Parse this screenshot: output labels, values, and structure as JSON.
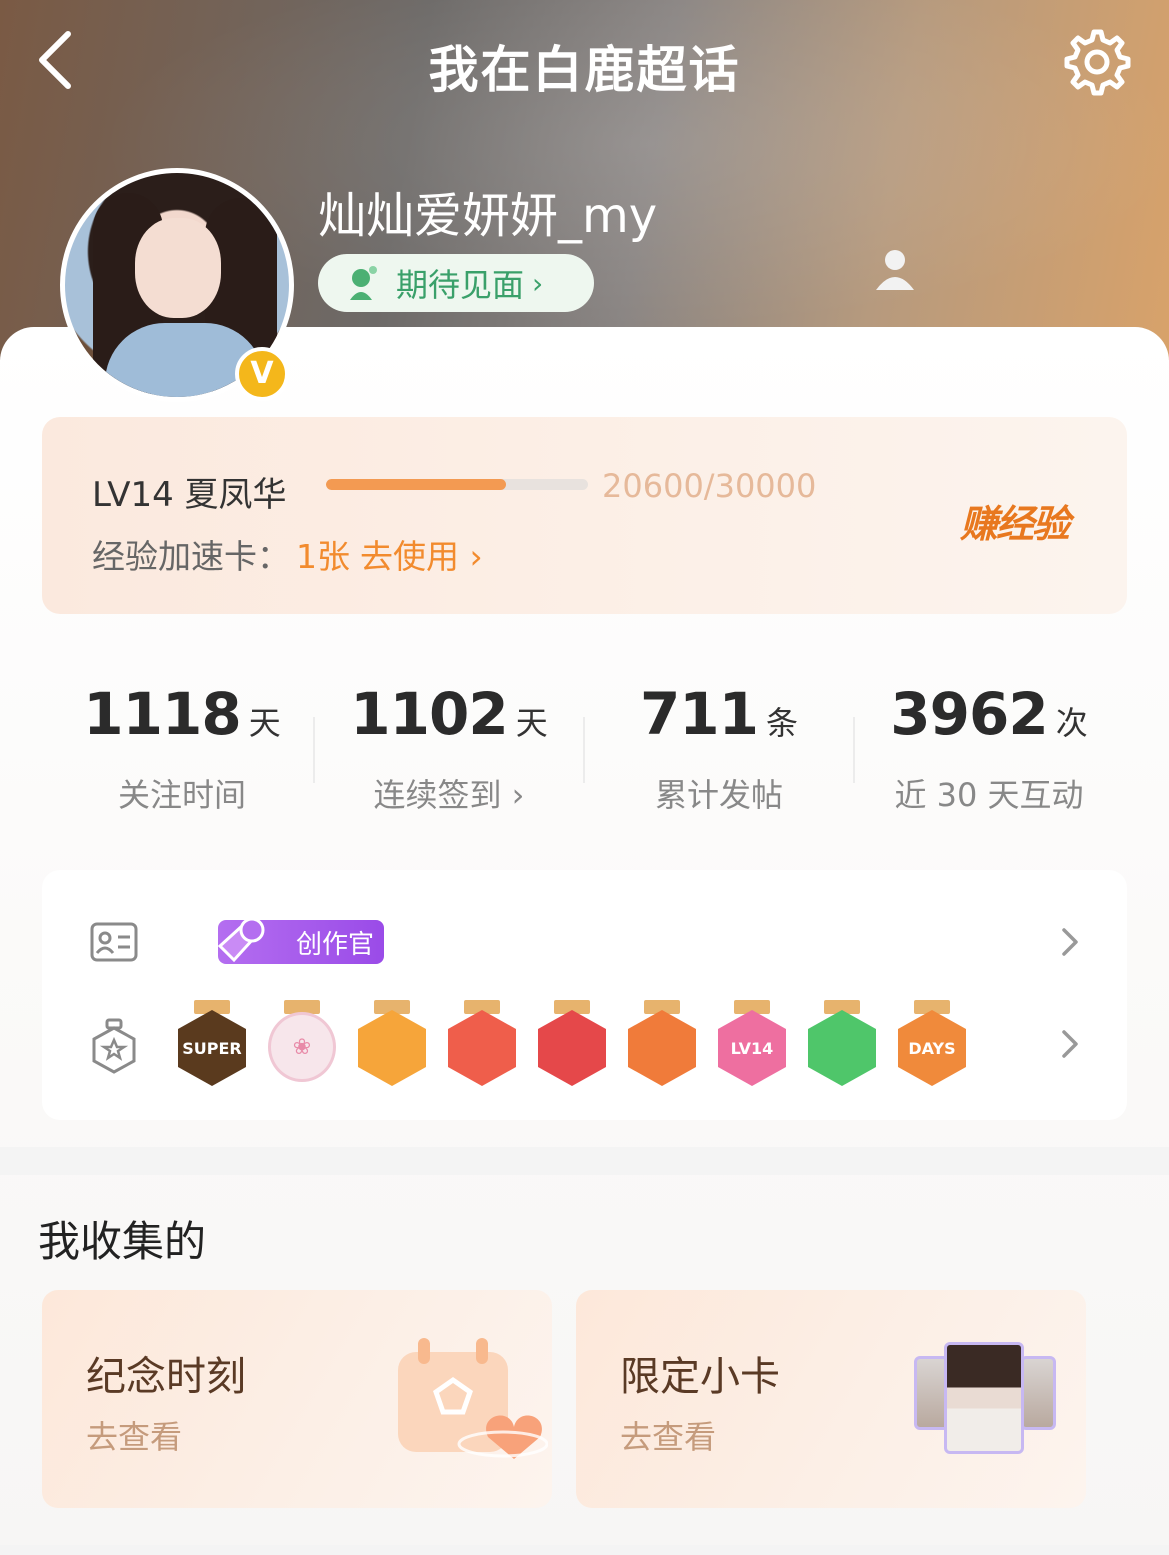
{
  "header": {
    "title": "我在白鹿超话"
  },
  "profile": {
    "username": "灿灿爱妍妍_my",
    "vip_mark": "V",
    "status_label": "期待见面",
    "status_chevron": "›"
  },
  "level": {
    "name": "LV14 夏凤华",
    "progress_text": "20600/30000",
    "progress_fraction": 0.6867,
    "accel_label": "经验加速卡：",
    "accel_count": "1张",
    "accel_use": "去使用 ›",
    "earn_label": "赚经验"
  },
  "stats": [
    {
      "value": "1118",
      "unit": "天",
      "label": "关注时间"
    },
    {
      "value": "1102",
      "unit": "天",
      "label": "连续签到 ›"
    },
    {
      "value": "711",
      "unit": "条",
      "label": "累计发帖"
    },
    {
      "value": "3962",
      "unit": "次",
      "label": "近 30 天互动"
    }
  ],
  "badges": {
    "creator_tag": "创作官",
    "medals": [
      {
        "name": "super-medal",
        "text": "SUPER",
        "color": "#5a3a1e"
      },
      {
        "name": "girl-portrait-medal",
        "text": "",
        "color": "#f7e6eb"
      },
      {
        "name": "crown-medal",
        "text": "",
        "color": "#f6a53a"
      },
      {
        "name": "rabbit-medal",
        "text": "",
        "color": "#ef5e4b"
      },
      {
        "name": "rabbit-medal-2",
        "text": "",
        "color": "#e5484a"
      },
      {
        "name": "fire-dragon-medal",
        "text": "",
        "color": "#f07b3a"
      },
      {
        "name": "lv14-medal",
        "text": "LV14",
        "color": "#ee6fa0"
      },
      {
        "name": "palm-medal",
        "text": "",
        "color": "#4fc66a"
      },
      {
        "name": "100-days-medal",
        "text": "DAYS",
        "color": "#f08a3b"
      }
    ]
  },
  "collection": {
    "title": "我收集的",
    "cards": [
      {
        "title": "纪念时刻",
        "subtitle": "去查看"
      },
      {
        "title": "限定小卡",
        "subtitle": "去查看"
      }
    ]
  }
}
